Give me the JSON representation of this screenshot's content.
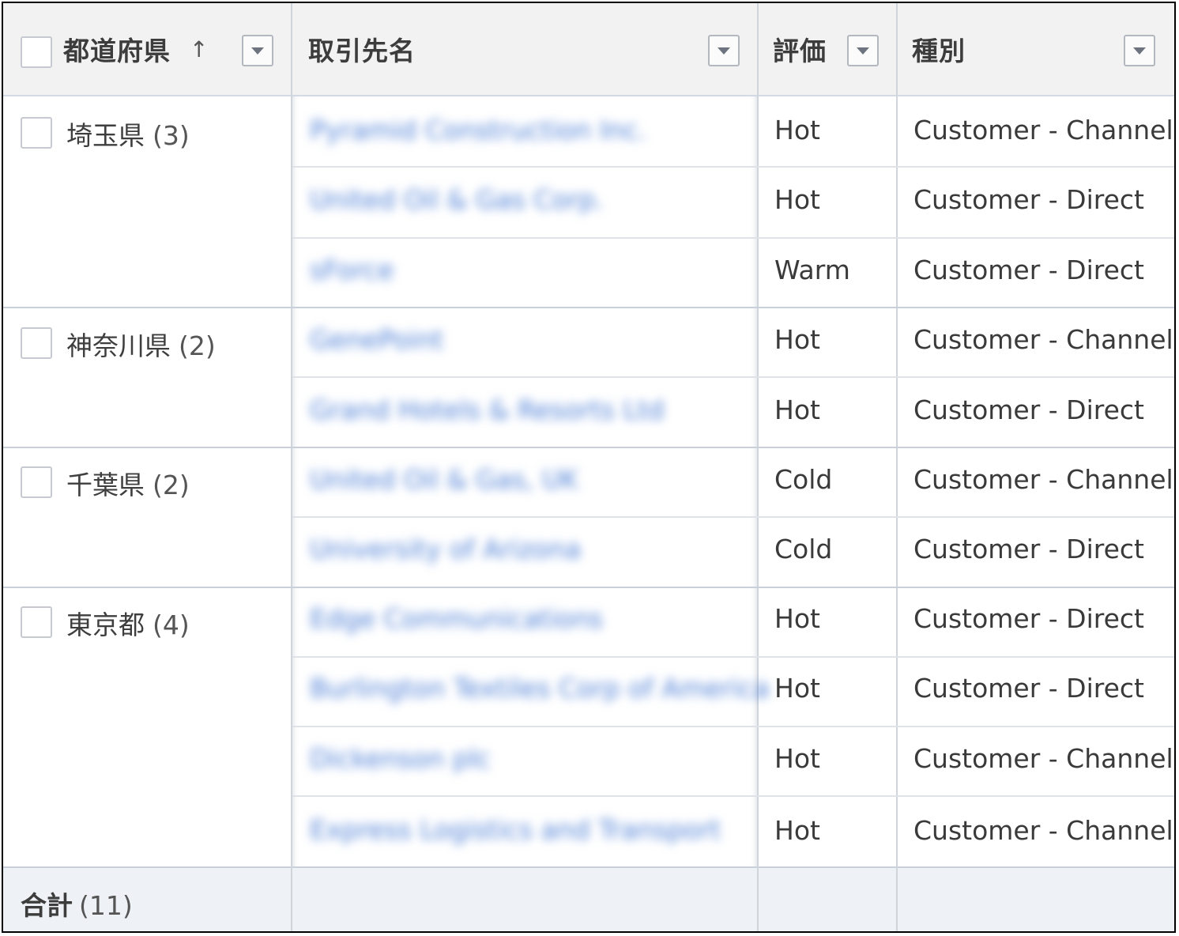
{
  "columns": {
    "prefecture": {
      "label": "都道府県",
      "sort_indicator": "↑"
    },
    "account_name": {
      "label": "取引先名"
    },
    "rating": {
      "label": "評価"
    },
    "type": {
      "label": "種別"
    }
  },
  "groups": [
    {
      "name": "埼玉県",
      "count": "(3)",
      "rows": [
        {
          "account": "Pyramid Construction Inc.",
          "rating": "Hot",
          "type": "Customer - Channel"
        },
        {
          "account": "United Oil & Gas Corp.",
          "rating": "Hot",
          "type": "Customer - Direct"
        },
        {
          "account": "sForce",
          "rating": "Warm",
          "type": "Customer - Direct"
        }
      ]
    },
    {
      "name": "神奈川県",
      "count": "(2)",
      "rows": [
        {
          "account": "GenePoint",
          "rating": "Hot",
          "type": "Customer - Channel"
        },
        {
          "account": "Grand Hotels & Resorts Ltd",
          "rating": "Hot",
          "type": "Customer - Direct"
        }
      ]
    },
    {
      "name": "千葉県",
      "count": "(2)",
      "rows": [
        {
          "account": "United Oil & Gas, UK",
          "rating": "Cold",
          "type": "Customer - Channel"
        },
        {
          "account": "University of Arizona",
          "rating": "Cold",
          "type": "Customer - Direct"
        }
      ]
    },
    {
      "name": "東京都",
      "count": "(4)",
      "rows": [
        {
          "account": "Edge Communications",
          "rating": "Hot",
          "type": "Customer - Direct"
        },
        {
          "account": "Burlington Textiles Corp of America",
          "rating": "Hot",
          "type": "Customer - Direct"
        },
        {
          "account": "Dickenson plc",
          "rating": "Hot",
          "type": "Customer - Channel"
        },
        {
          "account": "Express Logistics and Transport",
          "rating": "Hot",
          "type": "Customer - Channel"
        }
      ]
    }
  ],
  "footer": {
    "label": "合計",
    "count": "(11)"
  },
  "icons": {
    "sort": "arrow-up-icon",
    "filter": "dropdown-triangle-icon",
    "select": "checkbox-icon"
  }
}
